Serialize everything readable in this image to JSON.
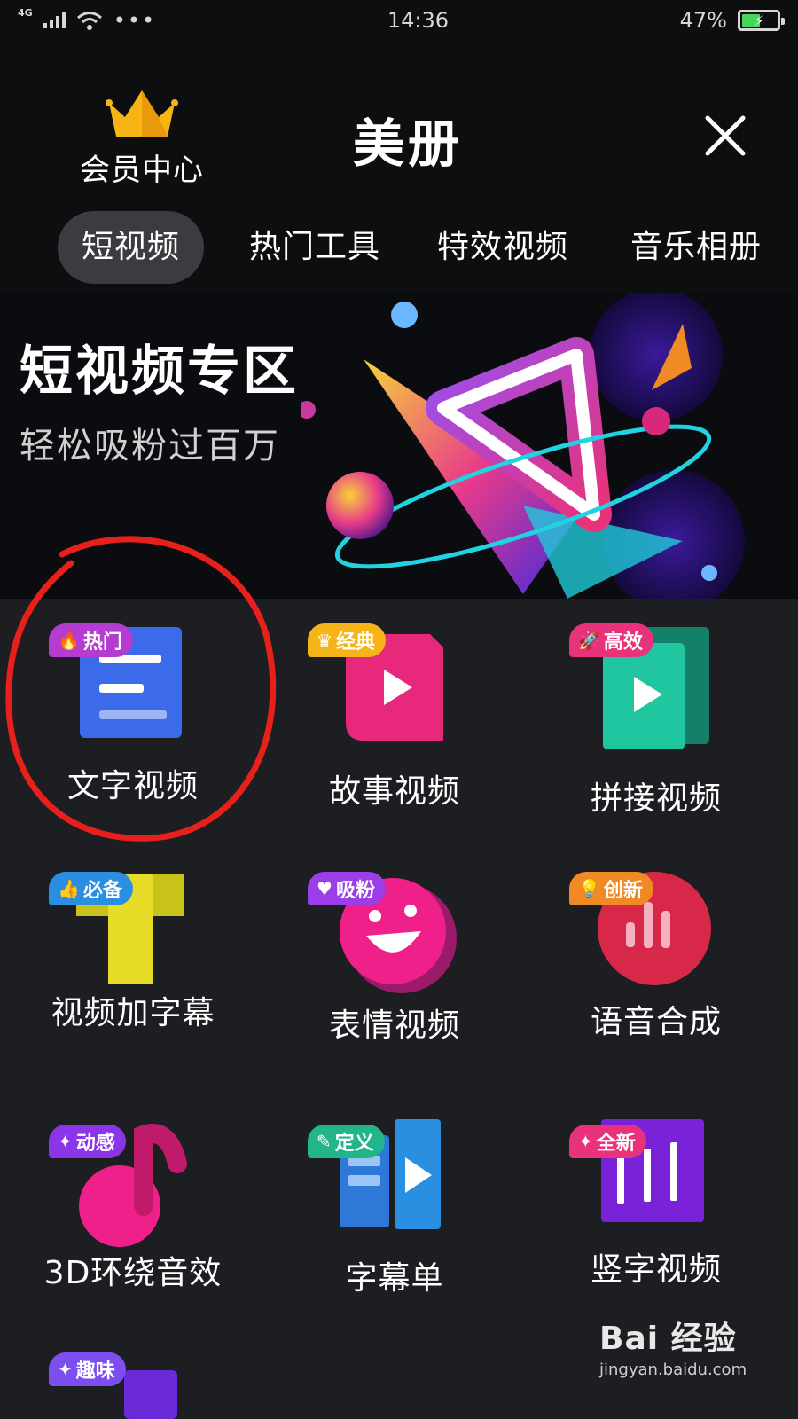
{
  "status_bar": {
    "network": "4G",
    "time": "14:36",
    "battery_percent": "47%",
    "battery_level": 0.47,
    "more_dots": "•••"
  },
  "header": {
    "vip_label": "会员中心",
    "logo_text": "美册"
  },
  "tabs": [
    {
      "label": "短视频",
      "active": true
    },
    {
      "label": "热门工具",
      "active": false
    },
    {
      "label": "特效视频",
      "active": false
    },
    {
      "label": "音乐相册",
      "active": false
    }
  ],
  "banner": {
    "title": "短视频专区",
    "subtitle": "轻松吸粉过百万"
  },
  "tools": [
    {
      "label": "文字视频",
      "badge": "热门",
      "badge_icon": "fire-icon",
      "badge_color": "#b43cd0",
      "icon": "text-doc-icon"
    },
    {
      "label": "故事视频",
      "badge": "经典",
      "badge_icon": "crown-icon",
      "badge_color": "#f4b41a",
      "icon": "story-video-icon"
    },
    {
      "label": "拼接视频",
      "badge": "高效",
      "badge_icon": "rocket-icon",
      "badge_color": "#e8327a",
      "icon": "splice-video-icon"
    },
    {
      "label": "视频加字幕",
      "badge": "必备",
      "badge_icon": "thumb-icon",
      "badge_color": "#2a8fe0",
      "icon": "subtitle-t-icon"
    },
    {
      "label": "表情视频",
      "badge": "吸粉",
      "badge_icon": "heart-icon",
      "badge_color": "#9b3ee8",
      "icon": "smiley-icon"
    },
    {
      "label": "语音合成",
      "badge": "创新",
      "badge_icon": "bulb-icon",
      "badge_color": "#f08a24",
      "icon": "voice-bars-icon"
    },
    {
      "label": "3D环绕音效",
      "badge": "动感",
      "badge_icon": "sparkle-icon",
      "badge_color": "#8a35e8",
      "icon": "music-note-icon"
    },
    {
      "label": "字幕单",
      "badge": "定义",
      "badge_icon": "pencil-icon",
      "badge_color": "#22b58a",
      "icon": "caption-list-icon"
    },
    {
      "label": "竖字视频",
      "badge": "全新",
      "badge_icon": "sparkle-icon",
      "badge_color": "#e8327a",
      "icon": "vertical-text-icon"
    },
    {
      "label": "",
      "badge": "趣味",
      "badge_icon": "sparkle-icon",
      "badge_color": "#7c4ef0",
      "icon": "fun-icon"
    }
  ],
  "watermark": {
    "logo": "Bai 经验",
    "url": "jingyan.baidu.com"
  },
  "colors": {
    "background": "#0d0e10",
    "grid_background": "#1c1e22",
    "tab_active": "#3a3c40",
    "annotation_red": "#e8201c"
  }
}
